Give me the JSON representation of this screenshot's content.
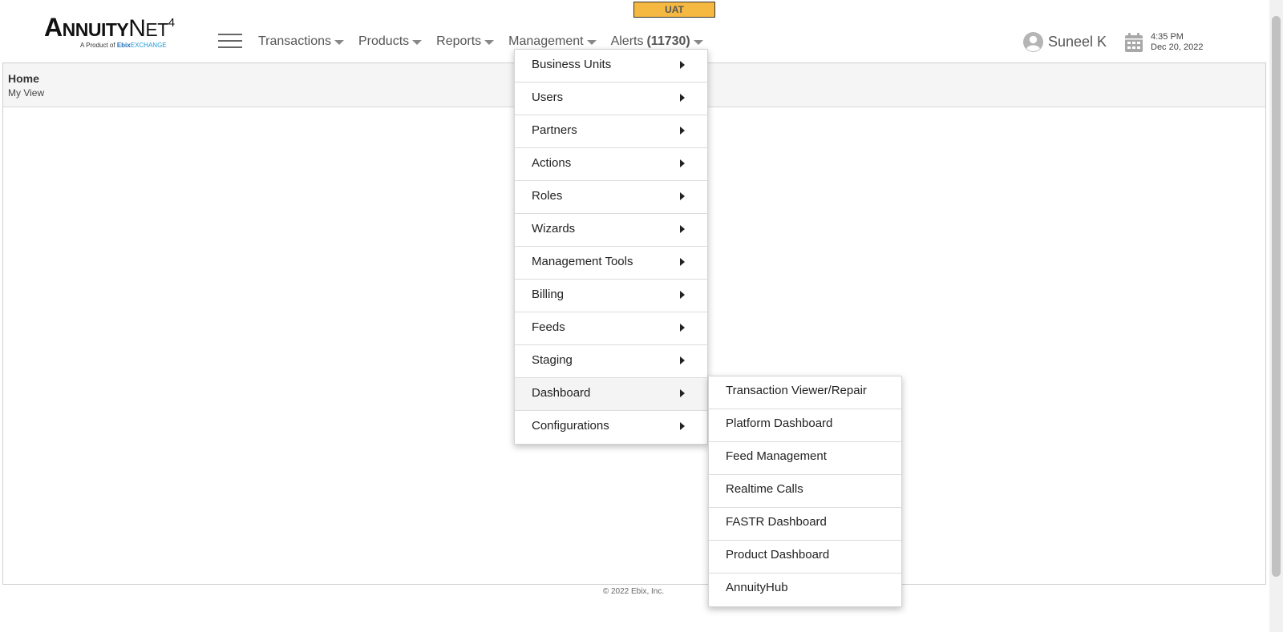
{
  "env_badge": "UAT",
  "logo": {
    "brand_first_big": "A",
    "brand_first_rest": "NNUITY",
    "brand_second_big": "N",
    "brand_second_rest": "ET",
    "version": "4",
    "tagline_prefix": "A Product of",
    "tagline_ebix": "Ebix",
    "tagline_exchange": "EXCHANGE"
  },
  "nav": {
    "items": [
      {
        "label": "Transactions"
      },
      {
        "label": "Products"
      },
      {
        "label": "Reports"
      },
      {
        "label": "Management"
      }
    ],
    "alerts_label": "Alerts",
    "alerts_count": "(11730)"
  },
  "user": {
    "name": "Suneel K",
    "time": "4:35 PM",
    "date": "Dec 20, 2022"
  },
  "breadcrumb": {
    "title": "Home",
    "subtitle": "My View"
  },
  "footer": "© 2022 Ebix, Inc.",
  "management_menu": {
    "items": [
      {
        "label": "Business Units"
      },
      {
        "label": "Users"
      },
      {
        "label": "Partners"
      },
      {
        "label": "Actions"
      },
      {
        "label": "Roles"
      },
      {
        "label": "Wizards"
      },
      {
        "label": "Management Tools"
      },
      {
        "label": "Billing"
      },
      {
        "label": "Feeds"
      },
      {
        "label": "Staging"
      },
      {
        "label": "Dashboard"
      },
      {
        "label": "Configurations"
      }
    ],
    "active_item": "Dashboard"
  },
  "dashboard_submenu": {
    "items": [
      {
        "label": "Transaction Viewer/Repair"
      },
      {
        "label": "Platform Dashboard"
      },
      {
        "label": "Feed Management"
      },
      {
        "label": "Realtime Calls"
      },
      {
        "label": "FASTR Dashboard"
      },
      {
        "label": "Product Dashboard"
      },
      {
        "label": "AnnuityHub"
      }
    ]
  },
  "colors": {
    "badge_bg": "#f5b840",
    "menu_active_bg": "#f4f4f4"
  },
  "icons": {
    "menu": "hamburger-icon",
    "user": "user-avatar-icon",
    "calendar": "calendar-icon",
    "submenu": "caret-right-icon",
    "dropdown": "caret-down-icon"
  }
}
